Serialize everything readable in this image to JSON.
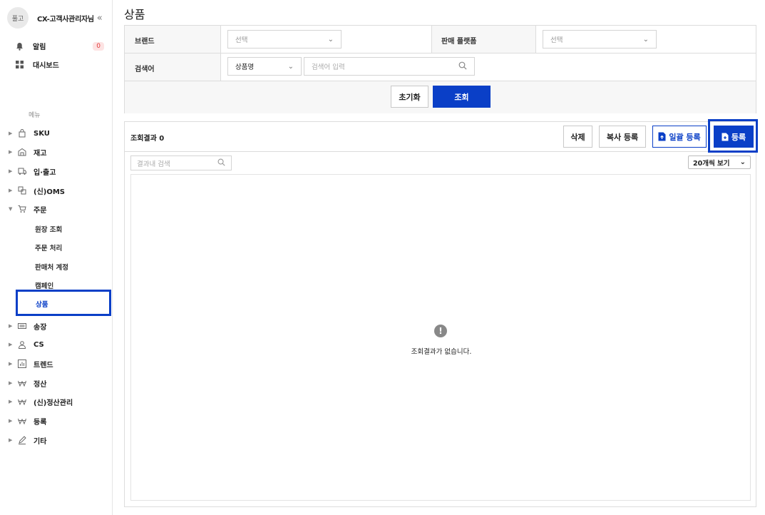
{
  "profile": {
    "avatar_text": "풀고",
    "name": "CX-고객사관리자님",
    "collapse_icon": "«"
  },
  "top_items": [
    {
      "label": "알림",
      "icon": "bell-icon",
      "badge": "0"
    },
    {
      "label": "대시보드",
      "icon": "dashboard-icon"
    }
  ],
  "menu_title": "메뉴",
  "nav": [
    {
      "label": "SKU",
      "icon": "bag-icon",
      "expanded": false
    },
    {
      "label": "재고",
      "icon": "warehouse-icon",
      "expanded": false
    },
    {
      "label": "입·출고",
      "icon": "truck-icon",
      "expanded": false
    },
    {
      "label": "(신)OMS",
      "icon": "exchange-icon",
      "expanded": false
    },
    {
      "label": "주문",
      "icon": "cart-icon",
      "expanded": true
    }
  ],
  "order_sub": [
    "원장 조회",
    "주문 처리",
    "판매처 계정",
    "캠페인",
    "상품"
  ],
  "nav2": [
    {
      "label": "송장",
      "icon": "invoice-icon"
    },
    {
      "label": "CS",
      "icon": "person-icon"
    },
    {
      "label": "트렌드",
      "icon": "chart-icon"
    },
    {
      "label": "정산",
      "icon": "won-icon"
    },
    {
      "label": "(신)정산관리",
      "icon": "won-icon"
    },
    {
      "label": "등록",
      "icon": "won-icon"
    },
    {
      "label": "기타",
      "icon": "pencil-icon"
    }
  ],
  "page_title": "상품",
  "filter": {
    "brand_label": "브랜드",
    "brand_placeholder": "선택",
    "platform_label": "판매 플랫폼",
    "platform_placeholder": "선택",
    "keyword_label": "검색어",
    "keyword_type": "상품명",
    "keyword_placeholder": "검색어 입력",
    "reset": "초기화",
    "search": "조회"
  },
  "results": {
    "count_label": "조회결과 0",
    "delete": "삭제",
    "copy_register": "복사 등록",
    "bulk_register": "일괄 등록",
    "register": "등록",
    "inner_search_placeholder": "결과내 검색",
    "page_size": "20개씩 보기",
    "empty_message": "조회결과가 없습니다."
  },
  "colors": {
    "primary": "#0a3fc7",
    "badge_bg": "#fde3e3",
    "badge_text": "#e23b3b"
  }
}
